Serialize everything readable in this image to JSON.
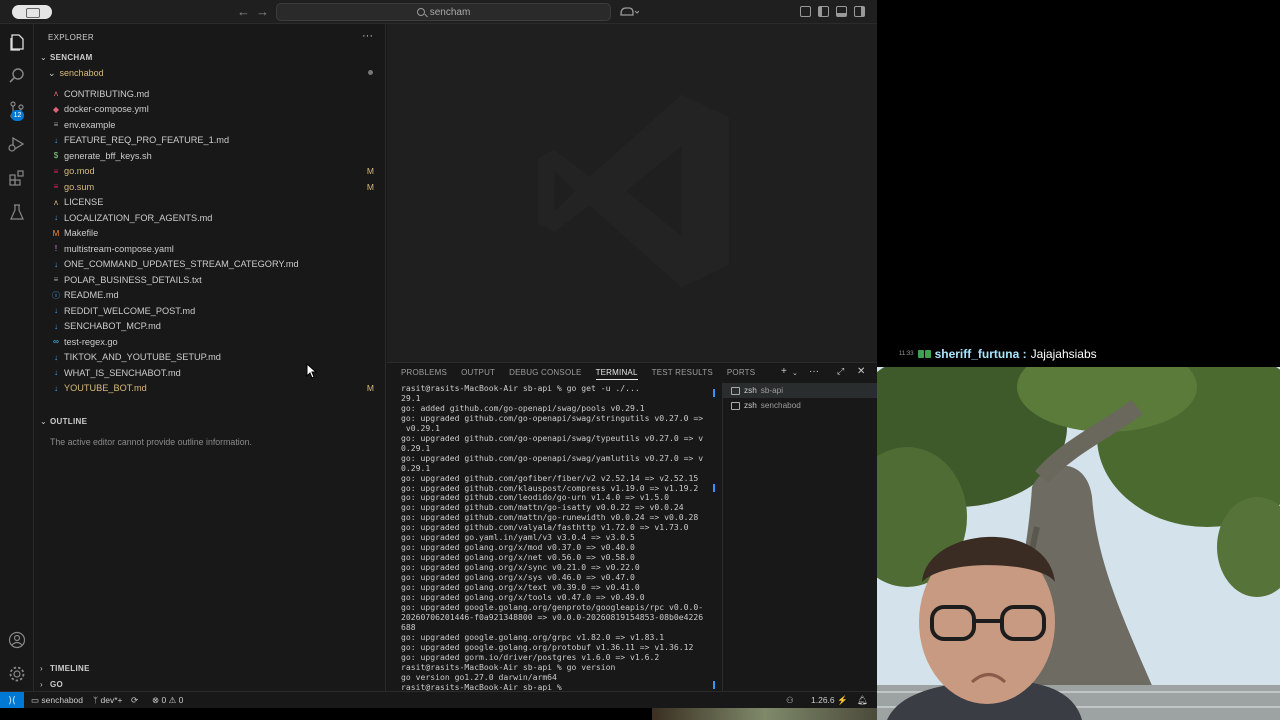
{
  "titlebar": {
    "search_text": "sencham",
    "back": "←",
    "forward": "→"
  },
  "activity_bar": {
    "items": [
      "explorer-icon",
      "search-icon",
      "source-control-icon",
      "run-debug-icon",
      "extensions-icon",
      "testing-icon"
    ],
    "scm_badge": "12",
    "bottom": [
      "account-icon",
      "settings-gear-icon"
    ]
  },
  "sidebar": {
    "header": "EXPLORER",
    "more": "···",
    "workspace": "SENCHAM",
    "folder": "senchabod",
    "files": [
      {
        "name": "CONTRIBUTING.md",
        "icon": "ʌ",
        "icon_color": "#e06c75",
        "status": ""
      },
      {
        "name": "docker-compose.yml",
        "icon": "◆",
        "icon_color": "#e0637a",
        "status": ""
      },
      {
        "name": "env.example",
        "icon": "≡",
        "icon_color": "#9aa0a6",
        "status": ""
      },
      {
        "name": "FEATURE_REQ_PRO_FEATURE_1.md",
        "icon": "↓",
        "icon_color": "#42a5f5",
        "status": ""
      },
      {
        "name": "generate_bff_keys.sh",
        "icon": "$",
        "icon_color": "#89d185",
        "status": ""
      },
      {
        "name": "go.mod",
        "icon": "≡",
        "icon_color": "#e91e63",
        "status": "M"
      },
      {
        "name": "go.sum",
        "icon": "≡",
        "icon_color": "#e91e63",
        "status": "M"
      },
      {
        "name": "LICENSE",
        "icon": "ʌ",
        "icon_color": "#d7ba7d",
        "status": ""
      },
      {
        "name": "LOCALIZATION_FOR_AGENTS.md",
        "icon": "↓",
        "icon_color": "#42a5f5",
        "status": ""
      },
      {
        "name": "Makefile",
        "icon": "M",
        "icon_color": "#ef8a3d",
        "status": ""
      },
      {
        "name": "multistream-compose.yaml",
        "icon": "!",
        "icon_color": "#cb9bd6",
        "status": ""
      },
      {
        "name": "ONE_COMMAND_UPDATES_STREAM_CATEGORY.md",
        "icon": "↓",
        "icon_color": "#42a5f5",
        "status": ""
      },
      {
        "name": "POLAR_BUSINESS_DETAILS.txt",
        "icon": "≡",
        "icon_color": "#9aa0a6",
        "status": ""
      },
      {
        "name": "README.md",
        "icon": "ⓘ",
        "icon_color": "#42a5f5",
        "status": ""
      },
      {
        "name": "REDDIT_WELCOME_POST.md",
        "icon": "↓",
        "icon_color": "#42a5f5",
        "status": ""
      },
      {
        "name": "SENCHABOT_MCP.md",
        "icon": "↓",
        "icon_color": "#42a5f5",
        "status": ""
      },
      {
        "name": "test-regex.go",
        "icon": "∞",
        "icon_color": "#4fc3f7",
        "status": ""
      },
      {
        "name": "TIKTOK_AND_YOUTUBE_SETUP.md",
        "icon": "↓",
        "icon_color": "#42a5f5",
        "status": ""
      },
      {
        "name": "WHAT_IS_SENCHABOT.md",
        "icon": "↓",
        "icon_color": "#42a5f5",
        "status": ""
      },
      {
        "name": "YOUTUBE_BOT.md",
        "icon": "↓",
        "icon_color": "#42a5f5",
        "status": "M"
      }
    ],
    "outline_title": "OUTLINE",
    "outline_message": "The active editor cannot provide outline information.",
    "timeline_title": "TIMELINE",
    "go_title": "GO"
  },
  "panel": {
    "tabs": [
      "PROBLEMS",
      "OUTPUT",
      "DEBUG CONSOLE",
      "TERMINAL",
      "TEST RESULTS",
      "PORTS"
    ],
    "active_tab": "TERMINAL",
    "terminal_lines": [
      "rasit@rasits-MacBook-Air sb-api % go get -u ./...",
      "29.1",
      "go: added github.com/go-openapi/swag/pools v0.29.1",
      "go: upgraded github.com/go-openapi/swag/stringutils v0.27.0 =>",
      " v0.29.1",
      "go: upgraded github.com/go-openapi/swag/typeutils v0.27.0 => v",
      "0.29.1",
      "go: upgraded github.com/go-openapi/swag/yamlutils v0.27.0 => v",
      "0.29.1",
      "go: upgraded github.com/gofiber/fiber/v2 v2.52.14 => v2.52.15",
      "go: upgraded github.com/klauspost/compress v1.19.0 => v1.19.2",
      "go: upgraded github.com/leodido/go-urn v1.4.0 => v1.5.0",
      "go: upgraded github.com/mattn/go-isatty v0.0.22 => v0.0.24",
      "go: upgraded github.com/mattn/go-runewidth v0.0.24 => v0.0.28",
      "go: upgraded github.com/valyala/fasthttp v1.72.0 => v1.73.0",
      "go: upgraded go.yaml.in/yaml/v3 v3.0.4 => v3.0.5",
      "go: upgraded golang.org/x/mod v0.37.0 => v0.40.0",
      "go: upgraded golang.org/x/net v0.56.0 => v0.58.0",
      "go: upgraded golang.org/x/sync v0.21.0 => v0.22.0",
      "go: upgraded golang.org/x/sys v0.46.0 => v0.47.0",
      "go: upgraded golang.org/x/text v0.39.0 => v0.41.0",
      "go: upgraded golang.org/x/tools v0.47.0 => v0.49.0",
      "go: upgraded google.golang.org/genproto/googleapis/rpc v0.0.0-",
      "20260706201446-f0a921348800 => v0.0.0-20260819154853-08b0e4226",
      "688",
      "go: upgraded google.golang.org/grpc v1.82.0 => v1.83.1",
      "go: upgraded google.golang.org/protobuf v1.36.11 => v1.36.12",
      "go: upgraded gorm.io/driver/postgres v1.6.0 => v1.6.2",
      "rasit@rasits-MacBook-Air sb-api % go version",
      "go version go1.27.0 darwin/arm64",
      "rasit@rasits-MacBook-Air sb-api % "
    ],
    "terminals": [
      {
        "name": "zsh",
        "sub": "sb-api",
        "selected": true
      },
      {
        "name": "zsh",
        "sub": "senchabod",
        "selected": false
      }
    ]
  },
  "statusbar": {
    "branch_folder": "senchabod",
    "branch": "dev*+",
    "errors": "0",
    "warnings": "0",
    "go_version": "1.26.6"
  },
  "stream": {
    "chat_time": "11:33",
    "chat_user": "sheriff_furtuna :",
    "chat_message": "Jajajahsiabs"
  }
}
